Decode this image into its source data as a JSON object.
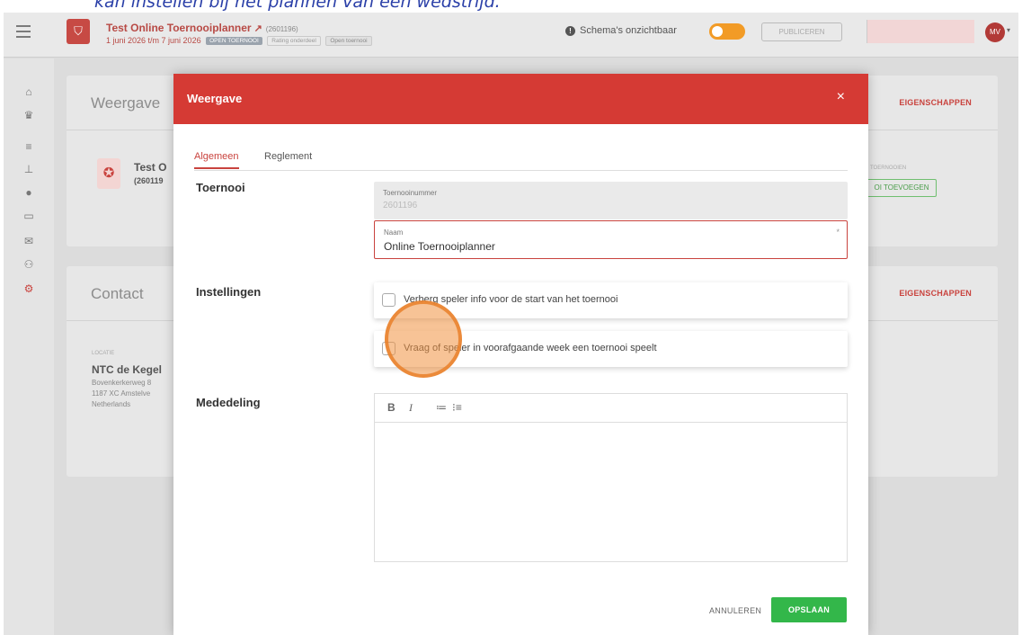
{
  "caption": "kan instellen bij het plannen van een wedstrijd.",
  "topbar": {
    "tournament_title": "Test Online Toernooiplanner",
    "tournament_id": "(2601196)",
    "dates": "1 juni 2026 t/m 7 juni 2026",
    "badges": [
      "OPEN TOERNOOI",
      "Rating onderdeel",
      "Open toernooi"
    ],
    "schema_status": "Schema's onzichtbaar",
    "publish_label": "PUBLICEREN",
    "avatar_initials": "MV",
    "accent": "#d53a34"
  },
  "sidebar_icons": [
    "home-icon",
    "trophy-icon",
    "list-icon",
    "tree-icon",
    "ball-icon",
    "monitor-icon",
    "mail-icon",
    "people-icon",
    "settings-icon"
  ],
  "background": {
    "weergave_title": "Weergave",
    "weergave_link": "EIGENSCHAPPEN",
    "tournament_name_partial": "Test O",
    "tournament_id_partial": "(260119",
    "toernooien_label": "TOERNOOIEN",
    "toevoegen_button": "OI TOEVOEGEN",
    "contact_title": "Contact",
    "contact_link": "EIGENSCHAPPEN",
    "locatie_label": "LOCATIE",
    "location_name": "NTC de Kegel",
    "address_lines": [
      "Bovenkerkerweg 8",
      "1187 XC Amstelve",
      "Netherlands"
    ]
  },
  "modal": {
    "title": "Weergave",
    "close_icon": "×",
    "tabs": [
      "Algemeen",
      "Reglement"
    ],
    "active_tab": "Algemeen",
    "sections": {
      "toernooi": "Toernooi",
      "instellingen": "Instellingen",
      "mededeling": "Mededeling"
    },
    "tournament_number_label": "Toernooinummer",
    "tournament_number_value": "2601196",
    "name_label": "Naam",
    "name_value": "Online Toernooiplanner",
    "required_marker": "*",
    "checkboxes": [
      {
        "label": "Verberg speler info voor de start van het toernooi",
        "checked": false
      },
      {
        "label": "Vraag of speler in voorafgaande week een toernooi speelt",
        "checked": false
      }
    ],
    "editor_toolbar": [
      "B",
      "I",
      "≔",
      "⁝≡"
    ],
    "editor_content": "",
    "cancel_label": "ANNULEREN",
    "save_label": "OPSLAAN",
    "save_color": "#33b74a"
  }
}
